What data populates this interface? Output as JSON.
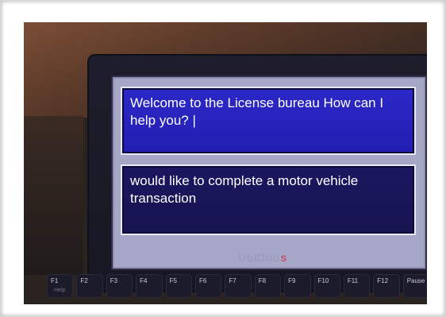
{
  "screen": {
    "top_message": "Welcome to the License bureau   How can I help you? |",
    "bottom_message": "would like to complete a motor vehicle transaction"
  },
  "device": {
    "brand": "UbiDuo",
    "brand_mark": "S"
  },
  "fkeys": [
    {
      "label": "F1",
      "sub": "Help"
    },
    {
      "label": "F2",
      "sub": ""
    },
    {
      "label": "F3",
      "sub": ""
    },
    {
      "label": "F4",
      "sub": ""
    },
    {
      "label": "F5",
      "sub": ""
    },
    {
      "label": "F6",
      "sub": ""
    },
    {
      "label": "F7",
      "sub": ""
    },
    {
      "label": "F8",
      "sub": ""
    },
    {
      "label": "F9",
      "sub": ""
    },
    {
      "label": "F10",
      "sub": ""
    },
    {
      "label": "F11",
      "sub": ""
    },
    {
      "label": "F12",
      "sub": ""
    },
    {
      "label": "Pause",
      "sub": ""
    }
  ]
}
